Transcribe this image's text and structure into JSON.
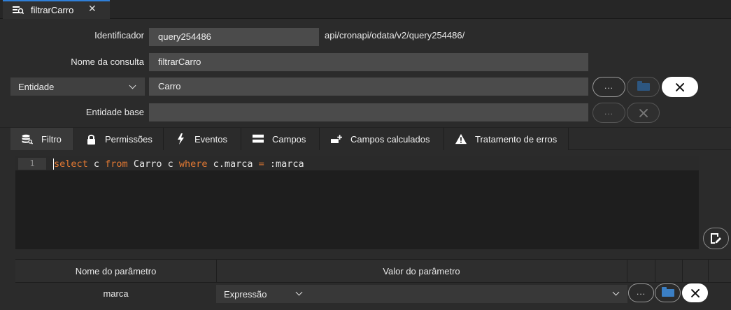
{
  "tab": {
    "title": "filtrarCarro",
    "close": "✕"
  },
  "form": {
    "identificador_label": "Identificador",
    "identificador_value": "query254486",
    "endpoint": "api/cronapi/odata/v2/query254486/",
    "nome_label": "Nome da consulta",
    "nome_value": "filtrarCarro",
    "entidade_select": "Entidade",
    "entidade_value": "Carro",
    "entidade_base_label": "Entidade base",
    "entidade_base_value": "",
    "ellipsis": "..."
  },
  "tabs": [
    {
      "label": "Filtro",
      "icon": "database-search-icon",
      "active": true
    },
    {
      "label": "Permissões",
      "icon": "lock-icon"
    },
    {
      "label": "Eventos",
      "icon": "lightning-icon"
    },
    {
      "label": "Campos",
      "icon": "fields-icon"
    },
    {
      "label": "Campos calculados",
      "icon": "add-field-icon"
    },
    {
      "label": "Tratamento de erros",
      "icon": "warning-icon"
    }
  ],
  "editor": {
    "line_number": "1",
    "tokens": [
      "select",
      " c ",
      "from",
      " Carro c ",
      "where",
      " c.marca ",
      "=",
      " :marca"
    ]
  },
  "params": {
    "col_name": "Nome do parâmetro",
    "col_value": "Valor do parâmetro",
    "rows": [
      {
        "name": "marca",
        "value_type": "Expressão",
        "ellipsis": "..."
      }
    ]
  },
  "colors": {
    "accent": "#2f7fd8",
    "keyword": "#e37933",
    "folder": "#3b7fc4",
    "background": "#2b2b2b"
  }
}
